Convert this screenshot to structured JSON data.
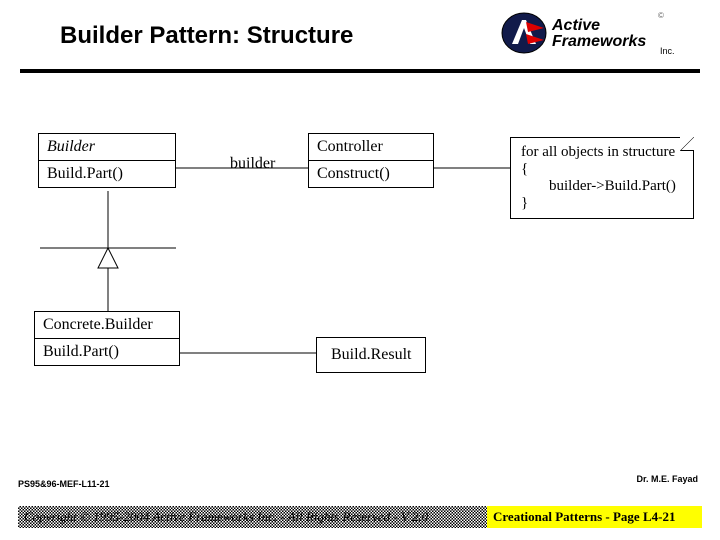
{
  "header": {
    "title": "Builder Pattern: Structure",
    "brand": {
      "name": "Active Frameworks",
      "sub": "Inc."
    }
  },
  "diagram": {
    "builder": {
      "name": "Builder",
      "op": "Build.Part()"
    },
    "controller": {
      "name": "Controller",
      "op": "Construct()"
    },
    "assoc_label": "builder",
    "note": {
      "line1": "for all objects in structure {",
      "line2": "builder->Build.Part()",
      "line3": "}"
    },
    "concrete": {
      "name": "Concrete.Builder",
      "op": "Build.Part()"
    },
    "result": {
      "label": "Build.Result"
    }
  },
  "footer": {
    "code": "PS95&96-MEF-L11-21",
    "author": "Dr. M.E. Fayad",
    "copyright": "Copyright © 1995-2004 Active Frameworks Inc. - All Rights Reserved - V 2.0",
    "page": "Creational Patterns - Page L4-21"
  }
}
